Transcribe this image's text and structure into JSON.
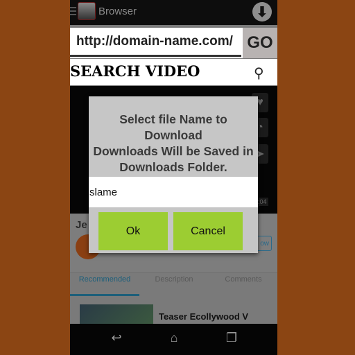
{
  "app": {
    "title": "Browser"
  },
  "url_bar": {
    "value": "http://domain-name.com/",
    "go_label": "GO"
  },
  "search": {
    "label": "SEARCH VIDEO"
  },
  "video": {
    "time": "5:04"
  },
  "channel": {
    "title": "Je",
    "follow_label": "ow"
  },
  "tabs": [
    {
      "label": "Recommended",
      "active": true
    },
    {
      "label": "Description",
      "active": false
    },
    {
      "label": "Comments",
      "active": false
    }
  ],
  "recommended": [
    {
      "title": "Teaser Ecollywood V"
    }
  ],
  "dialog": {
    "message_lines": [
      "Select file Name to Download",
      "Downloads Will be Saved in",
      "Downloads Folder."
    ],
    "input_value": "slame",
    "ok_label": "Ok",
    "cancel_label": "Cancel"
  },
  "colors": {
    "background": "#8B4513",
    "dialog_button": "#9ccd32",
    "tab_accent": "#1d5f7a"
  }
}
